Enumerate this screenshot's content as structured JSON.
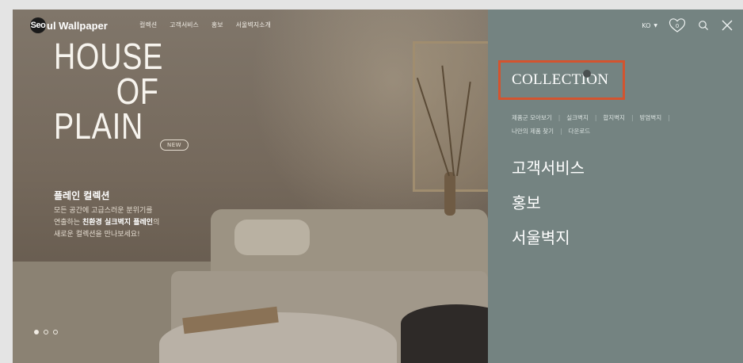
{
  "header": {
    "logo_circle": "Seo",
    "logo_text": "ul Wallpaper",
    "menu": [
      "컬렉션",
      "고객서비스",
      "홍보",
      "서울벽지소개"
    ]
  },
  "hero": {
    "headline": [
      "HOUSE",
      "OF",
      "PLAIN"
    ],
    "badge": "NEW",
    "subtitle": "플레인 컬렉션",
    "desc_line1": "모든 공간에 고급스러운 분위기를",
    "desc_line2_pre": "연출하는 ",
    "desc_line2_bold": "친환경 실크벽지 플레인",
    "desc_line2_post": "의",
    "desc_line3": "새로운 컬렉션을 만나보세요!",
    "slide_count": 3,
    "active_slide": 1
  },
  "panel": {
    "lang": "KO",
    "wishlist_count": "0",
    "collection_title": "COLLECTION",
    "sub_links_row1": [
      "제품군 모아보기",
      "실크벽지",
      "합지벽지",
      "방염벽지"
    ],
    "sub_links_row2": [
      "나만의 제품 찾기",
      "다운로드"
    ],
    "main_links": [
      "고객서비스",
      "홍보",
      "서울벽지"
    ]
  },
  "colors": {
    "panel_bg": "#748381",
    "highlight_border": "#d3542f"
  }
}
